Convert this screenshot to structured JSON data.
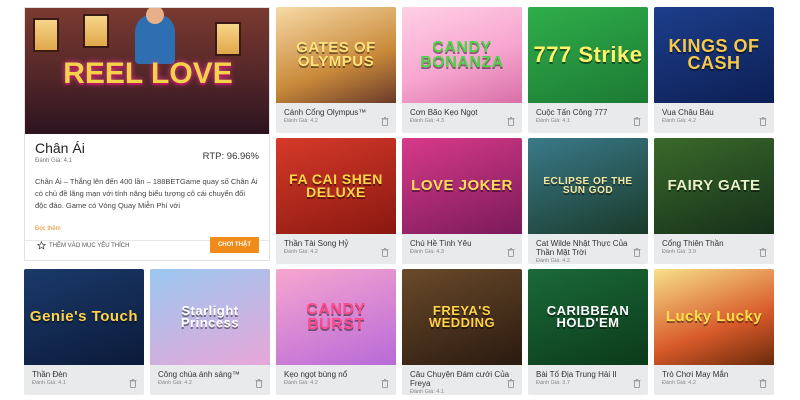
{
  "featured": {
    "hero_title": "REEL LOVE",
    "title": "Chân Ái",
    "rtp": "RTP: 96.96%",
    "rating": "Đánh Giá: 4.1",
    "description": "Chân Ái – Thắng lên đến 400 lần – 188BETGame quay số Chân Ái có chủ đề lãng mạn với tính năng biểu tượng cô cái chuyển đổi độc đáo. Game có Vòng Quay Miễn Phí với",
    "more_label": "Đọc thêm",
    "favorite_label": "THÊM VÀO MỤC YÊU THÍCH",
    "play_label": "CHƠI THẬT"
  },
  "games": [
    {
      "art": "GATES OF OLYMPUS",
      "name": "Cánh Cổng Olympus™",
      "rating": "Đánh Giá: 4.2"
    },
    {
      "art": "CANDY BONANZA",
      "name": "Cơn Bão Kẹo Ngọt",
      "rating": "Đánh Giá: 4.3"
    },
    {
      "art": "777 Strike",
      "name": "Cuộc Tấn Công 777",
      "rating": "Đánh Giá: 4.1"
    },
    {
      "art": "KINGS OF CASH",
      "name": "Vua Châu Báu",
      "rating": "Đánh Giá: 4.2"
    },
    {
      "art": "FA CAI SHEN DELUXE",
      "name": "Thần Tài Song Hỷ",
      "rating": "Đánh Giá: 4.2"
    },
    {
      "art": "LOVE JOKER",
      "name": "Chú Hề Tình Yêu",
      "rating": "Đánh Giá: 4.3"
    },
    {
      "art": "ECLIPSE OF THE SUN GOD",
      "name": "Cat Wilde Nhật Thực Của Thần Mặt Trời",
      "rating": "Đánh Giá: 4.2"
    },
    {
      "art": "FAIRY GATE",
      "name": "Cổng Thiên Thần",
      "rating": "Đánh Giá: 3.9"
    },
    {
      "art": "Genie's Touch",
      "name": "Thần Đèn",
      "rating": "Đánh Giá: 4.1"
    },
    {
      "art": "Starlight Princess",
      "name": "Công chúa ánh sáng™",
      "rating": "Đánh Giá: 4.2"
    },
    {
      "art": "CANDY BURST",
      "name": "Kẹo ngọt bùng nổ",
      "rating": "Đánh Giá: 4.2"
    },
    {
      "art": "FREYA'S WEDDING",
      "name": "Câu Chuyện Đám cưới Của Freya",
      "rating": "Đánh Giá: 4.1"
    },
    {
      "art": "CARIBBEAN HOLD'EM",
      "name": "Bài Tố Địa Trung Hải II",
      "rating": "Đánh Giá: 3.7"
    },
    {
      "art": "Lucky Lucky",
      "name": "Trò Chơi May Mắn",
      "rating": "Đánh Giá: 4.2"
    }
  ],
  "colors": {
    "accent": "#f08a18",
    "card_bg": "#e9eaec"
  },
  "icons": {
    "delete": "trash-icon",
    "favorite": "star-outline-icon"
  }
}
